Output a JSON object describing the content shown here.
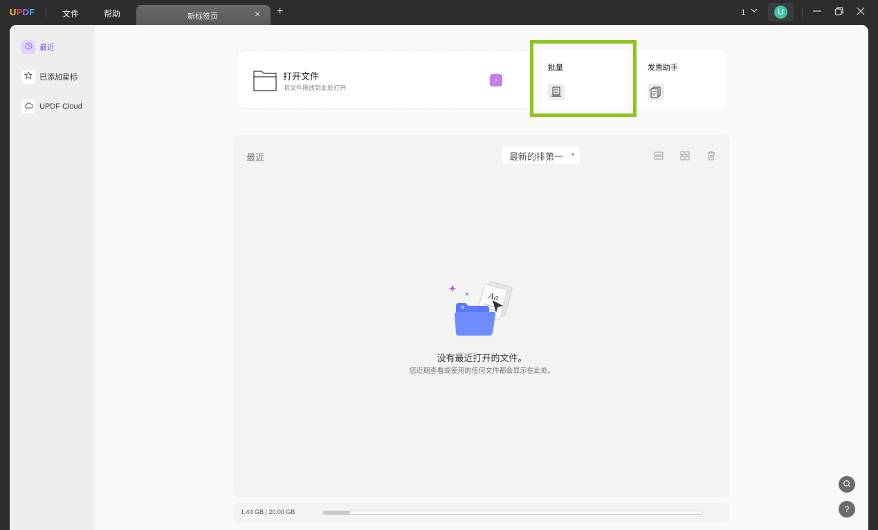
{
  "app": {
    "logo": [
      "U",
      "P",
      "D",
      "F"
    ],
    "menu": [
      "文件",
      "帮助"
    ],
    "tab": {
      "label": "新标签页",
      "close": "×"
    },
    "add_tab": "+",
    "page_indicator": "1",
    "avatar_letter": "U"
  },
  "sidebar": {
    "items": [
      {
        "label": "最近",
        "icon": "clock-icon",
        "active": true
      },
      {
        "label": "已添加星标",
        "icon": "star-icon",
        "active": false
      },
      {
        "label": "UPDF Cloud",
        "icon": "cloud-icon",
        "active": false
      }
    ]
  },
  "open_file": {
    "title": "打开文件",
    "subtitle": "将文件拖放到此处打开",
    "arrow": "›"
  },
  "tools": [
    {
      "label": "批量",
      "icon": "batch-icon"
    },
    {
      "label": "发票助手",
      "icon": "invoice-icon"
    }
  ],
  "recent": {
    "title": "最近",
    "sort": "最新的排第一",
    "empty_title": "没有最近打开的文件。",
    "empty_subtitle": "您近期查看或使用的任何文件都会显示在此处。"
  },
  "storage": {
    "text": "1.44 GB | 20.00 GB",
    "used_fraction": 0.072
  },
  "floating": {
    "search": "⌕",
    "help": "?"
  },
  "colors": {
    "accent": "#8b5cf6",
    "highlight": "#8fc31f",
    "avatar": "#3ec2a3"
  }
}
